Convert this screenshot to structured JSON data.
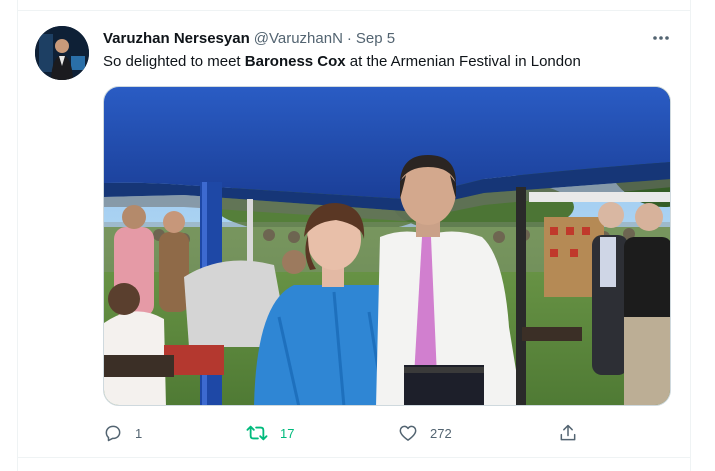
{
  "tweet": {
    "author_name": "Varuzhan Nersesyan",
    "author_handle": "@VaruzhanN",
    "separator": "·",
    "date": "Sep 5",
    "text_before": "So delighted to meet ",
    "text_bold": "Baroness Cox",
    "text_after": " at the Armenian Festival in London",
    "more_icon": "more-horizontal-icon"
  },
  "actions": {
    "reply_count": "1",
    "retweet_count": "17",
    "like_count": "272",
    "retweeted": true,
    "icons": [
      "reply-icon",
      "retweet-icon",
      "like-icon",
      "share-icon"
    ]
  },
  "colors": {
    "text_primary": "#0f1419",
    "text_secondary": "#536471",
    "retweet_active": "#00ba7c",
    "border": "#cfd9de",
    "tent_blue": "#1f4fb0"
  }
}
